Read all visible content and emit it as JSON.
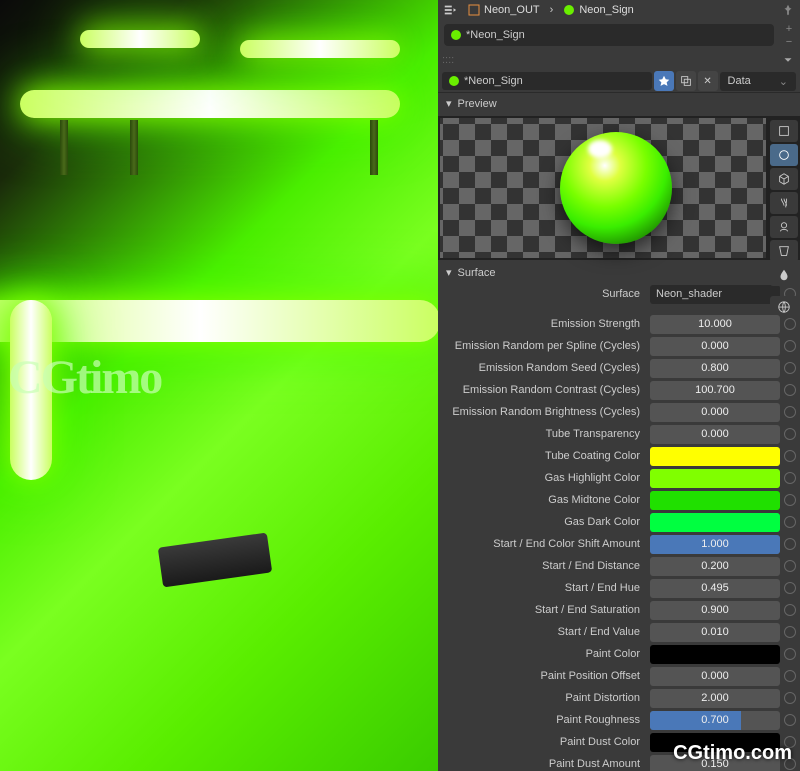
{
  "breadcrumb": {
    "object": "Neon_OUT",
    "material": "Neon_Sign"
  },
  "slot": {
    "name": "*Neon_Sign"
  },
  "datablock": {
    "name": "*Neon_Sign",
    "linked": "Data"
  },
  "sections": {
    "preview": "Preview",
    "surface": "Surface"
  },
  "surface": {
    "shader_label": "Surface",
    "shader_value": "Neon_shader",
    "props": [
      {
        "label": "Emission Strength",
        "value": "10.000",
        "type": "num"
      },
      {
        "label": "Emission Random per Spline (Cycles)",
        "value": "0.000",
        "type": "num"
      },
      {
        "label": "Emission Random Seed (Cycles)",
        "value": "0.800",
        "type": "num"
      },
      {
        "label": "Emission Random Contrast (Cycles)",
        "value": "100.700",
        "type": "num"
      },
      {
        "label": "Emission Random Brightness (Cycles)",
        "value": "0.000",
        "type": "num"
      },
      {
        "label": "Tube Transparency",
        "value": "0.000",
        "type": "num"
      },
      {
        "label": "Tube Coating Color",
        "value": "#ffff00",
        "type": "color"
      },
      {
        "label": "Gas Highlight Color",
        "value": "#80ff00",
        "type": "color"
      },
      {
        "label": "Gas Midtone Color",
        "value": "#20e000",
        "type": "color"
      },
      {
        "label": "Gas Dark Color",
        "value": "#00ff40",
        "type": "color"
      },
      {
        "label": "Start / End Color Shift Amount",
        "value": "1.000",
        "type": "slider-full"
      },
      {
        "label": "Start / End Distance",
        "value": "0.200",
        "type": "num"
      },
      {
        "label": "Start / End Hue",
        "value": "0.495",
        "type": "num"
      },
      {
        "label": "Start / End Saturation",
        "value": "0.900",
        "type": "num"
      },
      {
        "label": "Start / End Value",
        "value": "0.010",
        "type": "num"
      },
      {
        "label": "Paint Color",
        "value": "#000000",
        "type": "color"
      },
      {
        "label": "Paint Position Offset",
        "value": "0.000",
        "type": "num"
      },
      {
        "label": "Paint Distortion",
        "value": "2.000",
        "type": "num"
      },
      {
        "label": "Paint Roughness",
        "value": "0.700",
        "type": "slider-70"
      },
      {
        "label": "Paint Dust Color",
        "value": "#000000",
        "type": "color"
      },
      {
        "label": "Paint Dust Amount",
        "value": "0.150",
        "type": "num"
      }
    ]
  },
  "watermark": {
    "viewport": "CGtimo",
    "corner": "CGtimo.com"
  }
}
